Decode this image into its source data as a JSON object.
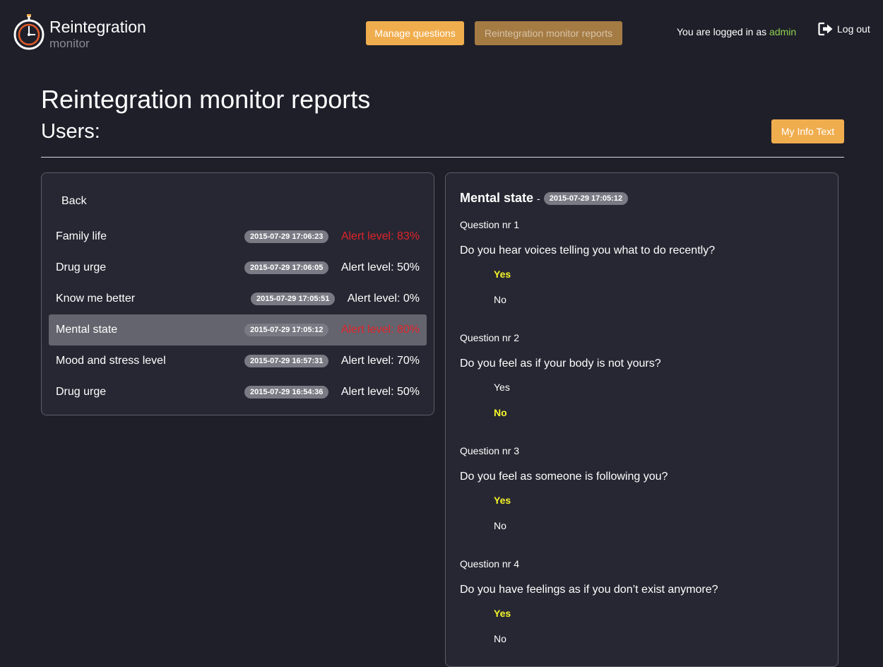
{
  "app": {
    "logo_main": "Reintegration",
    "logo_sub": "monitor"
  },
  "nav": {
    "manage_questions": "Manage questions",
    "monitor_reports": "Reintegration monitor reports",
    "logged_in_prefix": "You are logged in as",
    "username": "admin",
    "logout": "Log out"
  },
  "page": {
    "title": "Reintegration monitor reports",
    "subtitle": "Users:",
    "info_button": "My Info Text"
  },
  "reports": {
    "back": "Back",
    "items": [
      {
        "title": "Family life",
        "timestamp": "2015-07-29 17:06:23",
        "alert": "Alert level: 83%"
      },
      {
        "title": "Drug urge",
        "timestamp": "2015-07-29 17:06:05",
        "alert": "Alert level: 50%"
      },
      {
        "title": "Know me better",
        "timestamp": "2015-07-29 17:05:51",
        "alert": "Alert level: 0%"
      },
      {
        "title": "Mental state",
        "timestamp": "2015-07-29 17:05:12",
        "alert": "Alert level: 80%"
      },
      {
        "title": "Mood and stress level",
        "timestamp": "2015-07-29 16:57:31",
        "alert": "Alert level: 70%"
      },
      {
        "title": "Drug urge",
        "timestamp": "2015-07-29 16:54:36",
        "alert": "Alert level: 50%"
      }
    ]
  },
  "detail": {
    "title": "Mental state",
    "separator": "-",
    "timestamp": "2015-07-29 17:05:12",
    "questions": [
      {
        "nr": "Question nr 1",
        "text": "Do you hear voices telling you what to do recently?",
        "answers": [
          "Yes",
          "No"
        ],
        "selected": "Yes"
      },
      {
        "nr": "Question nr 2",
        "text": "Do you feel as if your body is not yours?",
        "answers": [
          "Yes",
          "No"
        ],
        "selected": "No"
      },
      {
        "nr": "Question nr 3",
        "text": "Do you feel as someone is following you?",
        "answers": [
          "Yes",
          "No"
        ],
        "selected": "Yes"
      },
      {
        "nr": "Question nr 4",
        "text": "Do you have feelings as if you don’t exist anymore?",
        "answers": [
          "Yes",
          "No"
        ],
        "selected": "Yes"
      }
    ]
  },
  "colors": {
    "background": "#1f1f2a",
    "panel": "#272733",
    "accent_orange": "#f0ad4e",
    "alert_red": "#e0242a",
    "selected_yellow": "#f5f52a",
    "username_green": "#8fd14f"
  },
  "icons": {
    "logo": "stopwatch-icon",
    "logout": "logout-icon"
  }
}
